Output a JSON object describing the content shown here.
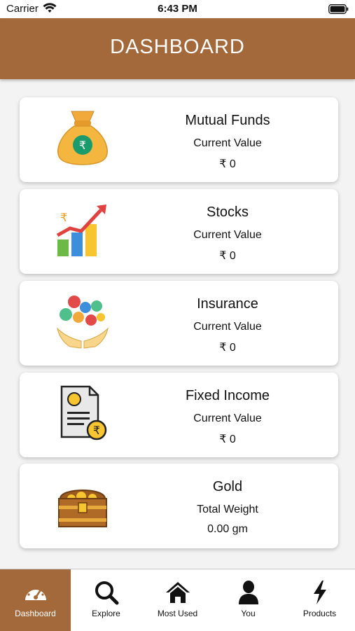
{
  "status_bar": {
    "carrier": "Carrier",
    "time": "6:43 PM"
  },
  "header": {
    "title": "DASHBOARD"
  },
  "cards": [
    {
      "title": "Mutual Funds",
      "label": "Current Value",
      "value": "₹ 0",
      "icon": "money-bag-icon"
    },
    {
      "title": "Stocks",
      "label": "Current Value",
      "value": "₹ 0",
      "icon": "stock-growth-icon"
    },
    {
      "title": "Insurance",
      "label": "Current Value",
      "value": "₹ 0",
      "icon": "insurance-hands-icon"
    },
    {
      "title": "Fixed Income",
      "label": "Current Value",
      "value": "₹ 0",
      "icon": "certificate-icon"
    },
    {
      "title": "Gold",
      "label": "Total Weight",
      "value": "0.00 gm",
      "icon": "treasure-chest-icon"
    }
  ],
  "tabs": [
    {
      "label": "Dashboard",
      "icon": "speedometer-icon",
      "active": true
    },
    {
      "label": "Explore",
      "icon": "search-icon",
      "active": false
    },
    {
      "label": "Most Used",
      "icon": "home-icon",
      "active": false
    },
    {
      "label": "You",
      "icon": "user-icon",
      "active": false
    },
    {
      "label": "Products",
      "icon": "lightning-icon",
      "active": false
    }
  ],
  "colors": {
    "brand": "#a4693a",
    "background": "#f3f3f3",
    "card": "#ffffff"
  }
}
